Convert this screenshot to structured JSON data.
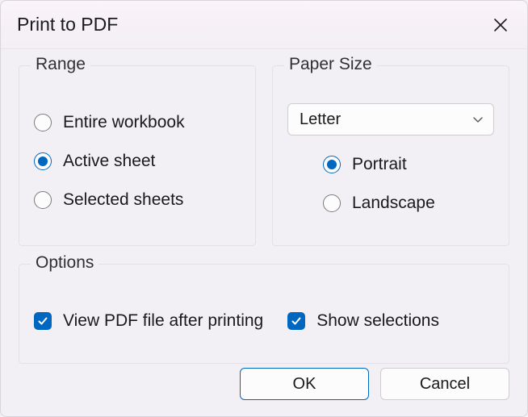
{
  "title": "Print to PDF",
  "range": {
    "legend": "Range",
    "entire": "Entire workbook",
    "active": "Active sheet",
    "selected": "Selected sheets",
    "value": "active"
  },
  "paper": {
    "legend": "Paper Size",
    "size_value": "Letter",
    "portrait": "Portrait",
    "landscape": "Landscape",
    "orientation": "portrait"
  },
  "options": {
    "legend": "Options",
    "view_after": "View PDF file after printing",
    "show_selections": "Show selections",
    "view_after_checked": true,
    "show_selections_checked": true
  },
  "buttons": {
    "ok": "OK",
    "cancel": "Cancel"
  },
  "colors": {
    "accent": "#0067c0"
  }
}
